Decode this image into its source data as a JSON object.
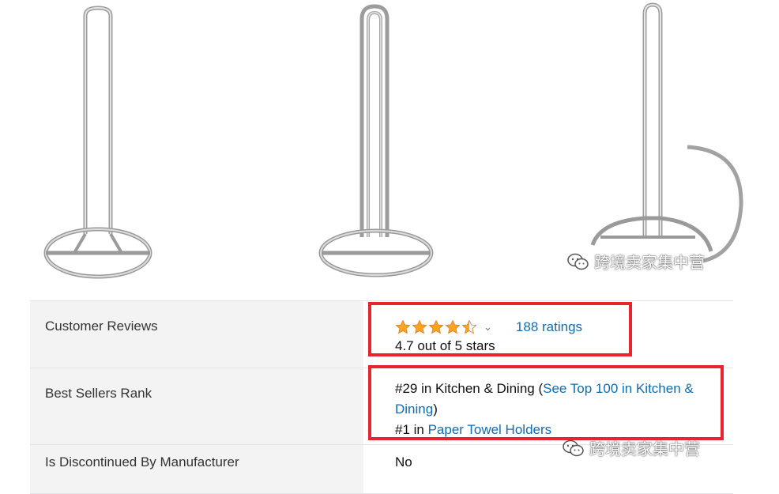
{
  "products": [
    {
      "name": "paper-towel-holder-1"
    },
    {
      "name": "paper-towel-holder-2"
    },
    {
      "name": "paper-towel-holder-3"
    }
  ],
  "watermark": {
    "text": "跨境卖家集中营"
  },
  "details": {
    "reviews": {
      "label": "Customer Reviews",
      "rating": 4.7,
      "ratings_text": "188 ratings",
      "out_of_text": "4.7 out of 5 stars"
    },
    "rank": {
      "label": "Best Sellers Rank",
      "line1_prefix": "#29 in Kitchen & Dining (",
      "line1_link": "See Top 100 in Kitchen & Dining",
      "line1_suffix": ")",
      "line2_prefix": "#1 in ",
      "line2_link": "Paper Towel Holders"
    },
    "discontinued": {
      "label": "Is Discontinued By Manufacturer",
      "value": "No"
    }
  },
  "colors": {
    "link": "#0f6db2",
    "highlight": "#e8242f",
    "star": "#ffa41c",
    "label_bg": "#f3f3f3"
  }
}
